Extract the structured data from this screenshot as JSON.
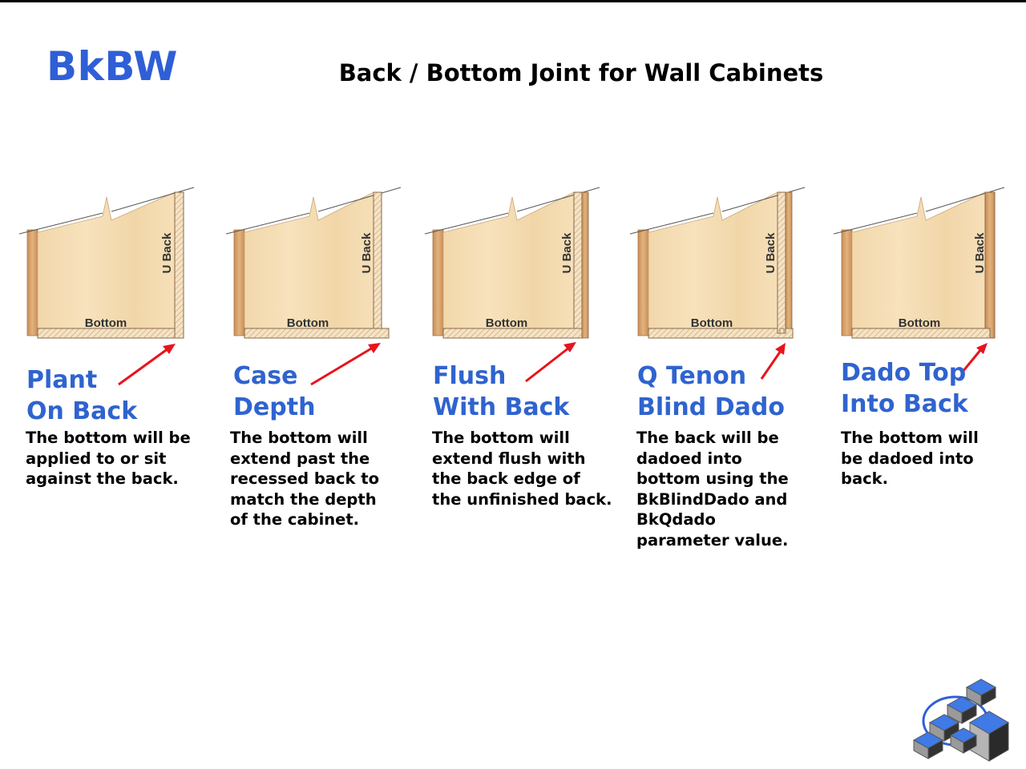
{
  "header": {
    "code": "BkBW",
    "title": "Back / Bottom Joint for Wall Cabinets"
  },
  "diagram_labels": {
    "back": "U Back",
    "bottom": "Bottom"
  },
  "options": [
    {
      "title_lines": [
        "Plant",
        "On Back"
      ],
      "description": "The bottom will be applied to or sit against the back."
    },
    {
      "title_lines": [
        "Case",
        "Depth"
      ],
      "description": "The bottom will extend past the recessed back to match the depth of the cabinet."
    },
    {
      "title_lines": [
        "Flush",
        "With Back"
      ],
      "description": "The bottom will extend flush with the back edge of the unfinished back."
    },
    {
      "title_lines": [
        "Q Tenon",
        "Blind Dado"
      ],
      "description": "The back will be dadoed into bottom using the BkBlindDado and BkQdado parameter value."
    },
    {
      "title_lines": [
        "Dado Top",
        "Into Back"
      ],
      "description": "The bottom will be dadoed into back."
    }
  ],
  "colors": {
    "code": "#2f5fd6",
    "option_title": "#2f63cf",
    "arrow": "#e8141b",
    "wood_light": "#f3dcb2",
    "wood_dark": "#d9a56e"
  },
  "icons": {
    "brand": "blue-cubes-logo-icon"
  }
}
